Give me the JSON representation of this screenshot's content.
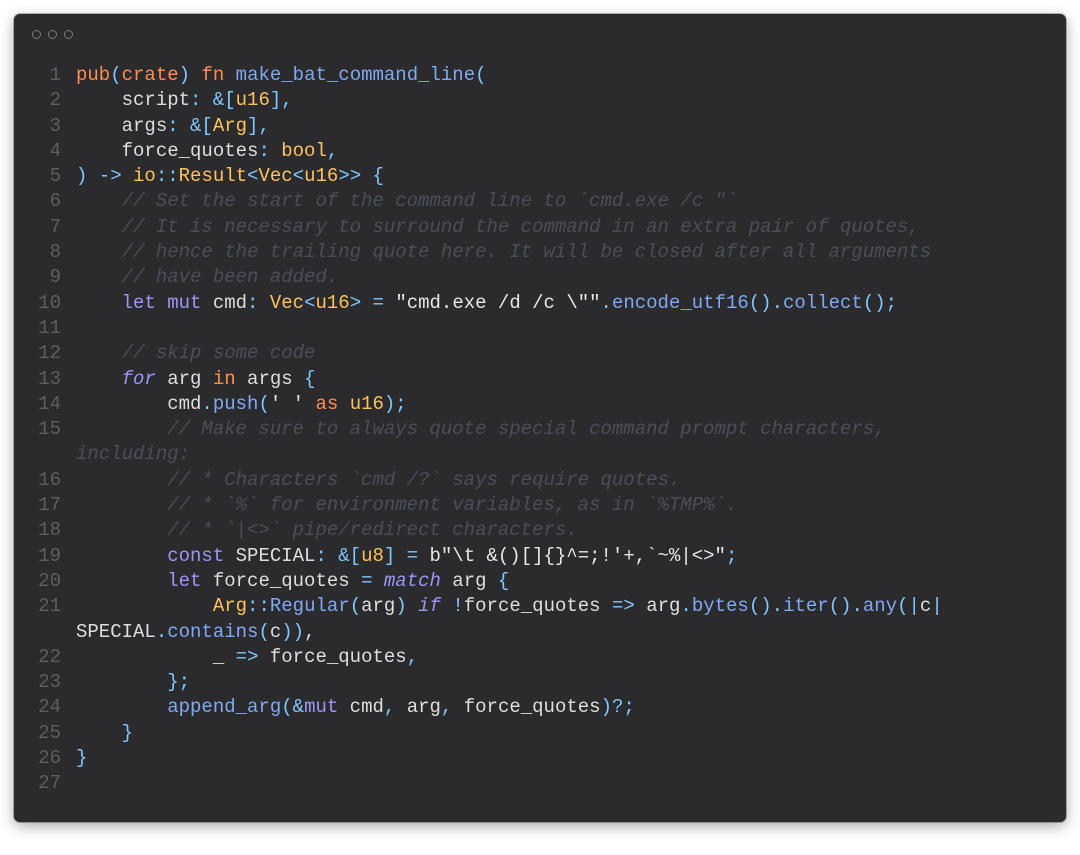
{
  "window": {
    "controls": [
      "close",
      "minimize",
      "maximize"
    ]
  },
  "code_lines": [
    {
      "n": "1",
      "t": [
        [
          "kw",
          "pub"
        ],
        [
          "op",
          "("
        ],
        [
          "kw",
          "crate"
        ],
        [
          "op",
          ")"
        ],
        [
          "plain",
          " "
        ],
        [
          "kw",
          "fn"
        ],
        [
          "plain",
          " "
        ],
        [
          "fn",
          "make_bat_command_line"
        ],
        [
          "op",
          "("
        ]
      ]
    },
    {
      "n": "2",
      "t": [
        [
          "plain",
          "    script"
        ],
        [
          "op",
          ": &["
        ],
        [
          "ty",
          "u16"
        ],
        [
          "op",
          "],"
        ]
      ]
    },
    {
      "n": "3",
      "t": [
        [
          "plain",
          "    args"
        ],
        [
          "op",
          ": &["
        ],
        [
          "ty",
          "Arg"
        ],
        [
          "op",
          "],"
        ]
      ]
    },
    {
      "n": "4",
      "t": [
        [
          "plain",
          "    force_quotes"
        ],
        [
          "op",
          ": "
        ],
        [
          "ty",
          "bool"
        ],
        [
          "op",
          ","
        ]
      ]
    },
    {
      "n": "5",
      "t": [
        [
          "op",
          ") -> "
        ],
        [
          "ty",
          "io"
        ],
        [
          "op",
          "::"
        ],
        [
          "ty",
          "Result"
        ],
        [
          "op",
          "<"
        ],
        [
          "ty",
          "Vec"
        ],
        [
          "op",
          "<"
        ],
        [
          "ty",
          "u16"
        ],
        [
          "op",
          ">> {"
        ]
      ]
    },
    {
      "n": "6",
      "t": [
        [
          "cm",
          "    // Set the start of the command line to `cmd.exe /c \"`"
        ]
      ]
    },
    {
      "n": "7",
      "t": [
        [
          "cm",
          "    // It is necessary to surround the command in an extra pair of quotes,"
        ]
      ]
    },
    {
      "n": "8",
      "t": [
        [
          "cm",
          "    // hence the trailing quote here. It will be closed after all arguments"
        ]
      ]
    },
    {
      "n": "9",
      "t": [
        [
          "cm",
          "    // have been added."
        ]
      ]
    },
    {
      "n": "10",
      "t": [
        [
          "plain",
          "    "
        ],
        [
          "kw2",
          "let mut"
        ],
        [
          "plain",
          " cmd"
        ],
        [
          "op",
          ": "
        ],
        [
          "ty",
          "Vec"
        ],
        [
          "op",
          "<"
        ],
        [
          "ty",
          "u16"
        ],
        [
          "op",
          "> = "
        ],
        [
          "str",
          "\"cmd.exe /d /c \\\"\""
        ],
        [
          "op",
          "."
        ],
        [
          "fn",
          "encode_utf16"
        ],
        [
          "op",
          "()."
        ],
        [
          "fn",
          "collect"
        ],
        [
          "op",
          "();"
        ]
      ]
    },
    {
      "n": "11",
      "t": []
    },
    {
      "n": "12",
      "t": [
        [
          "cm",
          "    // skip some code"
        ]
      ]
    },
    {
      "n": "13",
      "t": [
        [
          "plain",
          "    "
        ],
        [
          "it",
          "for"
        ],
        [
          "plain",
          " arg "
        ],
        [
          "kw",
          "in"
        ],
        [
          "plain",
          " args "
        ],
        [
          "op",
          "{"
        ]
      ]
    },
    {
      "n": "14",
      "t": [
        [
          "plain",
          "        cmd"
        ],
        [
          "op",
          "."
        ],
        [
          "fn",
          "push"
        ],
        [
          "op",
          "("
        ],
        [
          "str",
          "' '"
        ],
        [
          "plain",
          " "
        ],
        [
          "kw",
          "as"
        ],
        [
          "plain",
          " "
        ],
        [
          "ty",
          "u16"
        ],
        [
          "op",
          ");"
        ]
      ]
    },
    {
      "n": "15",
      "t": [
        [
          "cm",
          "        // Make sure to always quote special command prompt characters,"
        ]
      ]
    },
    {
      "n": "",
      "t": [
        [
          "cm",
          "including:"
        ]
      ]
    },
    {
      "n": "16",
      "t": [
        [
          "cm",
          "        // * Characters `cmd /?` says require quotes."
        ]
      ]
    },
    {
      "n": "17",
      "t": [
        [
          "cm",
          "        // * `%` for environment variables, as in `%TMP%`."
        ]
      ]
    },
    {
      "n": "18",
      "t": [
        [
          "cm",
          "        // * `|<>` pipe/redirect characters."
        ]
      ]
    },
    {
      "n": "19",
      "t": [
        [
          "plain",
          "        "
        ],
        [
          "kw2",
          "const"
        ],
        [
          "plain",
          " SPECIAL"
        ],
        [
          "op",
          ": &["
        ],
        [
          "ty",
          "u8"
        ],
        [
          "op",
          "] = "
        ],
        [
          "str",
          "b\"\\t &()[]{}^=;!'+,`~%|<>\""
        ],
        [
          "op",
          ";"
        ]
      ]
    },
    {
      "n": "20",
      "t": [
        [
          "plain",
          "        "
        ],
        [
          "kw2",
          "let"
        ],
        [
          "plain",
          " force_quotes "
        ],
        [
          "op",
          "= "
        ],
        [
          "it",
          "match"
        ],
        [
          "plain",
          " arg "
        ],
        [
          "op",
          "{"
        ]
      ]
    },
    {
      "n": "21",
      "t": [
        [
          "plain",
          "            "
        ],
        [
          "ty",
          "Arg"
        ],
        [
          "op",
          "::"
        ],
        [
          "fn",
          "Regular"
        ],
        [
          "op",
          "("
        ],
        [
          "plain",
          "arg"
        ],
        [
          "op",
          ") "
        ],
        [
          "it",
          "if"
        ],
        [
          "plain",
          " "
        ],
        [
          "op",
          "!"
        ],
        [
          "plain",
          "force_quotes "
        ],
        [
          "op",
          "=> "
        ],
        [
          "plain",
          "arg"
        ],
        [
          "op",
          "."
        ],
        [
          "fn",
          "bytes"
        ],
        [
          "op",
          "()."
        ],
        [
          "fn",
          "iter"
        ],
        [
          "op",
          "()."
        ],
        [
          "fn",
          "any"
        ],
        [
          "op",
          "(|"
        ],
        [
          "plain",
          "c"
        ],
        [
          "op",
          "|"
        ]
      ]
    },
    {
      "n": "",
      "t": [
        [
          "plain",
          "SPECIAL"
        ],
        [
          "op",
          "."
        ],
        [
          "fn",
          "contains"
        ],
        [
          "op",
          "("
        ],
        [
          "plain",
          "c"
        ],
        [
          "op",
          "))"
        ],
        [
          "plain",
          ","
        ]
      ]
    },
    {
      "n": "22",
      "t": [
        [
          "plain",
          "            _ "
        ],
        [
          "op",
          "=> "
        ],
        [
          "plain",
          "force_quotes"
        ],
        [
          "op",
          ","
        ]
      ]
    },
    {
      "n": "23",
      "t": [
        [
          "op",
          "        };"
        ]
      ]
    },
    {
      "n": "24",
      "t": [
        [
          "plain",
          "        "
        ],
        [
          "fn",
          "append_arg"
        ],
        [
          "op",
          "(&"
        ],
        [
          "kw2",
          "mut"
        ],
        [
          "plain",
          " cmd"
        ],
        [
          "op",
          ", "
        ],
        [
          "plain",
          "arg"
        ],
        [
          "op",
          ", "
        ],
        [
          "plain",
          "force_quotes"
        ],
        [
          "op",
          ")?;"
        ]
      ]
    },
    {
      "n": "25",
      "t": [
        [
          "op",
          "    }"
        ]
      ]
    },
    {
      "n": "26",
      "t": [
        [
          "op",
          "}"
        ]
      ]
    },
    {
      "n": "27",
      "t": []
    }
  ]
}
